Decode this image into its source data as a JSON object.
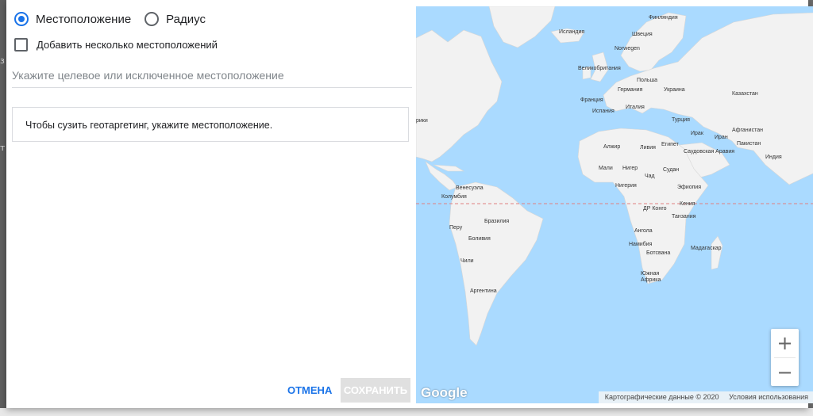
{
  "form": {
    "radio_location": "Местоположение",
    "radio_radius": "Радиус",
    "multi_location_label": "Добавить несколько местоположений",
    "search_placeholder": "Укажите целевое или исключенное местоположение",
    "search_value": "",
    "hint": "Чтобы сузить геотаргетинг, укажите местоположение."
  },
  "actions": {
    "cancel": "Отмена",
    "save": "Сохранить"
  },
  "map": {
    "logo": "Google",
    "attribution_data": "Картографические данные © 2020",
    "attribution_terms": "Условия использования",
    "zoom_in": "+",
    "zoom_out": "−",
    "labels": {
      "finland": "Финляндия",
      "iceland": "Исландия",
      "sweden": "Швеция",
      "norway": "Norwegen",
      "uk": "Великобритания",
      "poland": "Польша",
      "germany": "Германия",
      "ukraine": "Украина",
      "france": "Франция",
      "italy": "Италия",
      "spain": "Испания",
      "kazakhstan": "Казахстан",
      "turkey": "Турция",
      "iraq": "Ирак",
      "iran": "Иран",
      "afghanistan": "Афганистан",
      "pakistan": "Пакистан",
      "india": "Индия",
      "algeria": "Алжир",
      "libya": "Ливия",
      "egypt": "Египет",
      "saudi": "Саудовская Аравия",
      "mali": "Мали",
      "niger": "Нигер",
      "chad": "Чад",
      "sudan": "Судан",
      "nigeria": "Нигерия",
      "ethiopia": "Эфиопия",
      "venezuela": "Венесуэла",
      "colombia": "Колумбия",
      "drc": "ДР Конго",
      "kenya": "Кения",
      "tanzania": "Танзания",
      "brazil": "Бразилия",
      "peru": "Перу",
      "bolivia": "Боливия",
      "angola": "Ангола",
      "namibia": "Намибия",
      "botswana": "Ботсвана",
      "madagascar": "Мадагаскар",
      "chile": "Чили",
      "south_africa_1": "Южная",
      "south_africa_2": "Африка",
      "argentina": "Аргентина",
      "america_fragment": "рики"
    }
  }
}
